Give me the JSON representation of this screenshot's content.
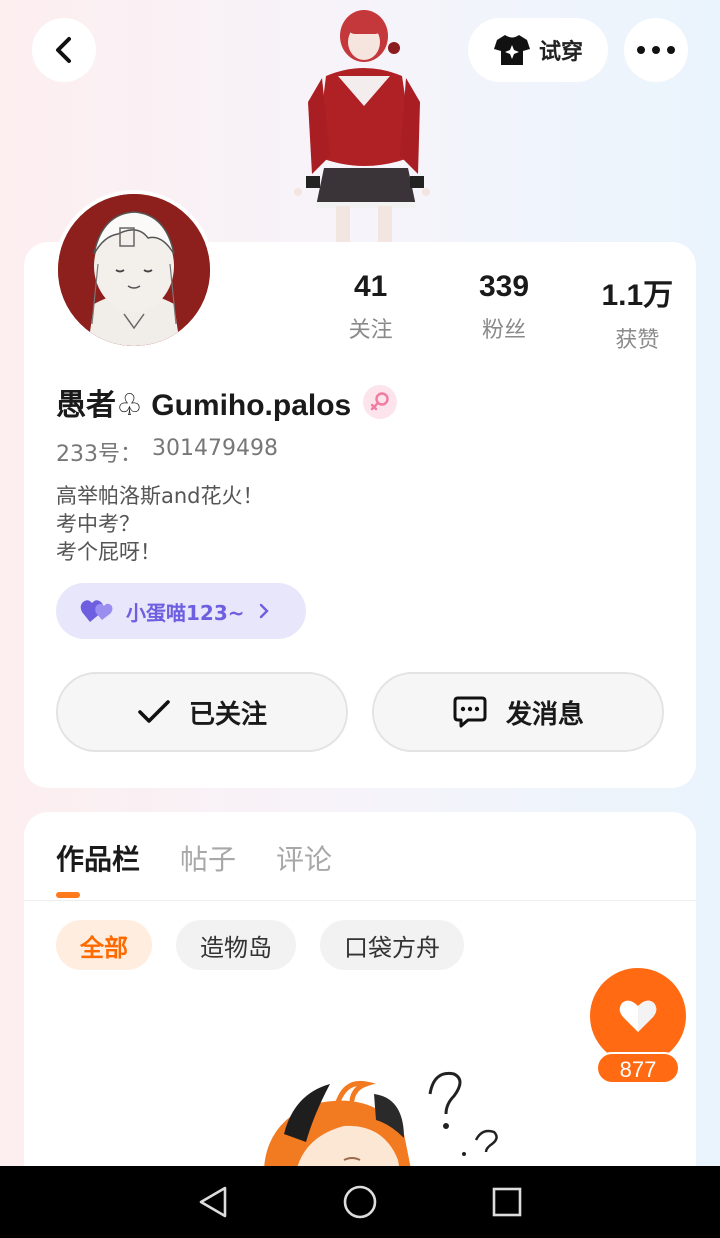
{
  "header": {
    "back_icon": "chevron-left-icon",
    "tryon_label": "试穿",
    "tryon_icon": "shirt-sparkle-icon",
    "more_icon": "more-horizontal-icon"
  },
  "profile": {
    "stats": [
      {
        "value": "41",
        "label": "关注"
      },
      {
        "value": "339",
        "label": "粉丝"
      },
      {
        "value": "1.1万",
        "label": "获赞"
      }
    ],
    "username": "愚者♧ Gumiho.palos",
    "gender_icon": "female-icon",
    "uid_label": "233号：",
    "uid_value": "301479498",
    "bio_lines": [
      "高举帕洛斯and花火！",
      "考中考？",
      "考个屁呀！"
    ],
    "cp_tag": {
      "name": "小蛋喵123~",
      "icon": "double-heart-icon"
    },
    "follow_button": "已关注",
    "message_button": "发消息"
  },
  "works": {
    "tabs": [
      {
        "label": "作品栏",
        "active": true
      },
      {
        "label": "帖子",
        "active": false
      },
      {
        "label": "评论",
        "active": false
      }
    ],
    "chips": [
      {
        "label": "全部",
        "active": true
      },
      {
        "label": "造物岛",
        "active": false
      },
      {
        "label": "口袋方舟",
        "active": false
      }
    ]
  },
  "like": {
    "count": "877",
    "icon": "heart-icon"
  },
  "navbar": {
    "items": [
      "back-triangle-icon",
      "home-circle-icon",
      "recents-square-icon"
    ]
  },
  "colors": {
    "accent": "#ff6a13",
    "cp_tag_bg": "#e8e6fb",
    "cp_tag_text": "#6d5fe0"
  }
}
